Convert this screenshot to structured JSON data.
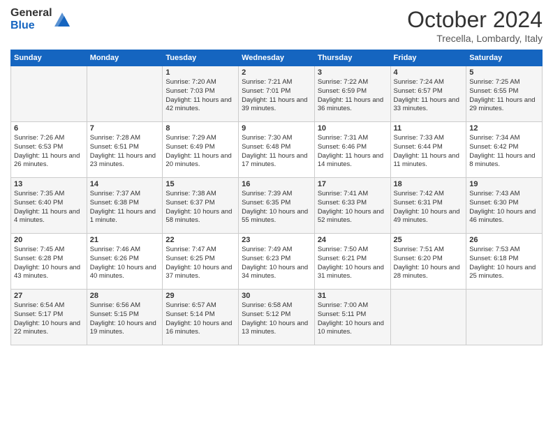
{
  "logo": {
    "general": "General",
    "blue": "Blue"
  },
  "title": "October 2024",
  "subtitle": "Trecella, Lombardy, Italy",
  "days_of_week": [
    "Sunday",
    "Monday",
    "Tuesday",
    "Wednesday",
    "Thursday",
    "Friday",
    "Saturday"
  ],
  "weeks": [
    [
      {
        "day": "",
        "content": ""
      },
      {
        "day": "",
        "content": ""
      },
      {
        "day": "1",
        "content": "Sunrise: 7:20 AM\nSunset: 7:03 PM\nDaylight: 11 hours and 42 minutes."
      },
      {
        "day": "2",
        "content": "Sunrise: 7:21 AM\nSunset: 7:01 PM\nDaylight: 11 hours and 39 minutes."
      },
      {
        "day": "3",
        "content": "Sunrise: 7:22 AM\nSunset: 6:59 PM\nDaylight: 11 hours and 36 minutes."
      },
      {
        "day": "4",
        "content": "Sunrise: 7:24 AM\nSunset: 6:57 PM\nDaylight: 11 hours and 33 minutes."
      },
      {
        "day": "5",
        "content": "Sunrise: 7:25 AM\nSunset: 6:55 PM\nDaylight: 11 hours and 29 minutes."
      }
    ],
    [
      {
        "day": "6",
        "content": "Sunrise: 7:26 AM\nSunset: 6:53 PM\nDaylight: 11 hours and 26 minutes."
      },
      {
        "day": "7",
        "content": "Sunrise: 7:28 AM\nSunset: 6:51 PM\nDaylight: 11 hours and 23 minutes."
      },
      {
        "day": "8",
        "content": "Sunrise: 7:29 AM\nSunset: 6:49 PM\nDaylight: 11 hours and 20 minutes."
      },
      {
        "day": "9",
        "content": "Sunrise: 7:30 AM\nSunset: 6:48 PM\nDaylight: 11 hours and 17 minutes."
      },
      {
        "day": "10",
        "content": "Sunrise: 7:31 AM\nSunset: 6:46 PM\nDaylight: 11 hours and 14 minutes."
      },
      {
        "day": "11",
        "content": "Sunrise: 7:33 AM\nSunset: 6:44 PM\nDaylight: 11 hours and 11 minutes."
      },
      {
        "day": "12",
        "content": "Sunrise: 7:34 AM\nSunset: 6:42 PM\nDaylight: 11 hours and 8 minutes."
      }
    ],
    [
      {
        "day": "13",
        "content": "Sunrise: 7:35 AM\nSunset: 6:40 PM\nDaylight: 11 hours and 4 minutes."
      },
      {
        "day": "14",
        "content": "Sunrise: 7:37 AM\nSunset: 6:38 PM\nDaylight: 11 hours and 1 minute."
      },
      {
        "day": "15",
        "content": "Sunrise: 7:38 AM\nSunset: 6:37 PM\nDaylight: 10 hours and 58 minutes."
      },
      {
        "day": "16",
        "content": "Sunrise: 7:39 AM\nSunset: 6:35 PM\nDaylight: 10 hours and 55 minutes."
      },
      {
        "day": "17",
        "content": "Sunrise: 7:41 AM\nSunset: 6:33 PM\nDaylight: 10 hours and 52 minutes."
      },
      {
        "day": "18",
        "content": "Sunrise: 7:42 AM\nSunset: 6:31 PM\nDaylight: 10 hours and 49 minutes."
      },
      {
        "day": "19",
        "content": "Sunrise: 7:43 AM\nSunset: 6:30 PM\nDaylight: 10 hours and 46 minutes."
      }
    ],
    [
      {
        "day": "20",
        "content": "Sunrise: 7:45 AM\nSunset: 6:28 PM\nDaylight: 10 hours and 43 minutes."
      },
      {
        "day": "21",
        "content": "Sunrise: 7:46 AM\nSunset: 6:26 PM\nDaylight: 10 hours and 40 minutes."
      },
      {
        "day": "22",
        "content": "Sunrise: 7:47 AM\nSunset: 6:25 PM\nDaylight: 10 hours and 37 minutes."
      },
      {
        "day": "23",
        "content": "Sunrise: 7:49 AM\nSunset: 6:23 PM\nDaylight: 10 hours and 34 minutes."
      },
      {
        "day": "24",
        "content": "Sunrise: 7:50 AM\nSunset: 6:21 PM\nDaylight: 10 hours and 31 minutes."
      },
      {
        "day": "25",
        "content": "Sunrise: 7:51 AM\nSunset: 6:20 PM\nDaylight: 10 hours and 28 minutes."
      },
      {
        "day": "26",
        "content": "Sunrise: 7:53 AM\nSunset: 6:18 PM\nDaylight: 10 hours and 25 minutes."
      }
    ],
    [
      {
        "day": "27",
        "content": "Sunrise: 6:54 AM\nSunset: 5:17 PM\nDaylight: 10 hours and 22 minutes."
      },
      {
        "day": "28",
        "content": "Sunrise: 6:56 AM\nSunset: 5:15 PM\nDaylight: 10 hours and 19 minutes."
      },
      {
        "day": "29",
        "content": "Sunrise: 6:57 AM\nSunset: 5:14 PM\nDaylight: 10 hours and 16 minutes."
      },
      {
        "day": "30",
        "content": "Sunrise: 6:58 AM\nSunset: 5:12 PM\nDaylight: 10 hours and 13 minutes."
      },
      {
        "day": "31",
        "content": "Sunrise: 7:00 AM\nSunset: 5:11 PM\nDaylight: 10 hours and 10 minutes."
      },
      {
        "day": "",
        "content": ""
      },
      {
        "day": "",
        "content": ""
      }
    ]
  ]
}
